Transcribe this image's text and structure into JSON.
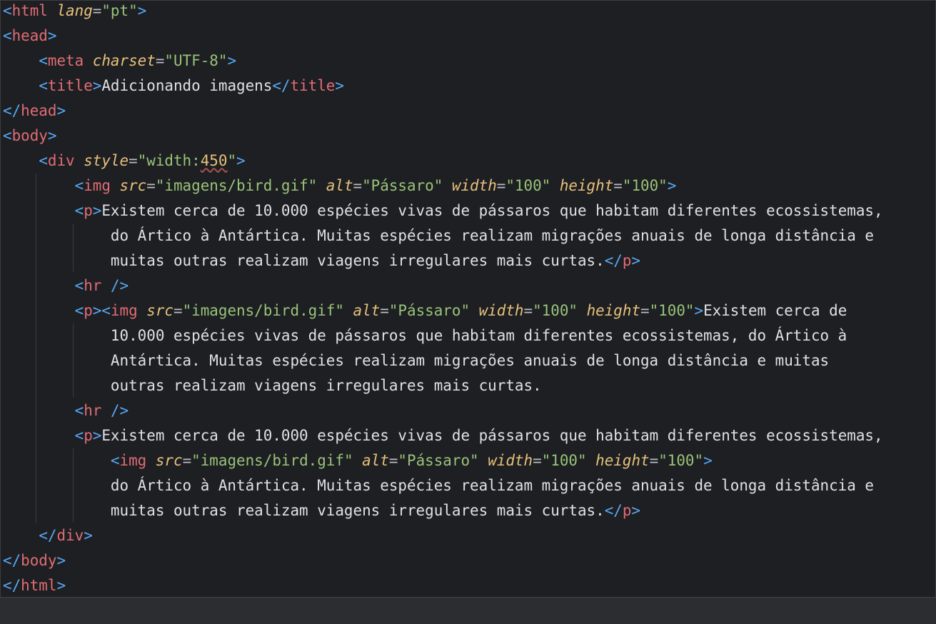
{
  "editor": {
    "language": "html",
    "lines": [
      [
        {
          "k": "p",
          "t": "<"
        },
        {
          "k": "t",
          "t": "html"
        },
        {
          "k": "o",
          "t": " "
        },
        {
          "k": "a",
          "t": "lang"
        },
        {
          "k": "o",
          "t": "="
        },
        {
          "k": "v",
          "t": "\"pt\""
        },
        {
          "k": "p",
          "t": ">"
        }
      ],
      [
        {
          "k": "p",
          "t": "<"
        },
        {
          "k": "t",
          "t": "head"
        },
        {
          "k": "p",
          "t": ">"
        }
      ],
      [
        {
          "k": "o",
          "t": "    "
        },
        {
          "k": "p",
          "t": "<"
        },
        {
          "k": "t",
          "t": "meta"
        },
        {
          "k": "o",
          "t": " "
        },
        {
          "k": "a",
          "t": "charset"
        },
        {
          "k": "o",
          "t": "="
        },
        {
          "k": "v",
          "t": "\"UTF-8\""
        },
        {
          "k": "p",
          "t": ">"
        }
      ],
      [
        {
          "k": "o",
          "t": "    "
        },
        {
          "k": "p",
          "t": "<"
        },
        {
          "k": "t",
          "t": "title"
        },
        {
          "k": "p",
          "t": ">"
        },
        {
          "k": "x",
          "t": "Adicionando imagens"
        },
        {
          "k": "p",
          "t": "</"
        },
        {
          "k": "t",
          "t": "title"
        },
        {
          "k": "p",
          "t": ">"
        }
      ],
      [
        {
          "k": "p",
          "t": "</"
        },
        {
          "k": "t",
          "t": "head"
        },
        {
          "k": "p",
          "t": ">"
        }
      ],
      [
        {
          "k": "p",
          "t": "<"
        },
        {
          "k": "t",
          "t": "body"
        },
        {
          "k": "p",
          "t": ">"
        }
      ],
      [
        {
          "k": "o",
          "t": "    "
        },
        {
          "k": "p",
          "t": "<"
        },
        {
          "k": "t",
          "t": "div"
        },
        {
          "k": "o",
          "t": " "
        },
        {
          "k": "a",
          "t": "style"
        },
        {
          "k": "o",
          "t": "="
        },
        {
          "k": "v",
          "t": "\"width:"
        },
        {
          "k": "n",
          "t": "450"
        },
        {
          "k": "v",
          "t": "\""
        },
        {
          "k": "p",
          "t": ">"
        }
      ],
      [
        {
          "k": "o",
          "t": "        "
        },
        {
          "k": "p",
          "t": "<"
        },
        {
          "k": "t",
          "t": "img"
        },
        {
          "k": "o",
          "t": " "
        },
        {
          "k": "a",
          "t": "src"
        },
        {
          "k": "o",
          "t": "="
        },
        {
          "k": "v",
          "t": "\"imagens/bird.gif\""
        },
        {
          "k": "o",
          "t": " "
        },
        {
          "k": "a",
          "t": "alt"
        },
        {
          "k": "o",
          "t": "="
        },
        {
          "k": "v",
          "t": "\"Pássaro\""
        },
        {
          "k": "o",
          "t": " "
        },
        {
          "k": "a",
          "t": "width"
        },
        {
          "k": "o",
          "t": "="
        },
        {
          "k": "v",
          "t": "\"100\""
        },
        {
          "k": "o",
          "t": " "
        },
        {
          "k": "a",
          "t": "height"
        },
        {
          "k": "o",
          "t": "="
        },
        {
          "k": "v",
          "t": "\"100\""
        },
        {
          "k": "p",
          "t": ">"
        }
      ],
      [
        {
          "k": "o",
          "t": "        "
        },
        {
          "k": "p",
          "t": "<"
        },
        {
          "k": "t",
          "t": "p"
        },
        {
          "k": "p",
          "t": ">"
        },
        {
          "k": "x",
          "t": "Existem cerca de 10.000 espécies vivas de pássaros que habitam diferentes ecossistemas,"
        }
      ],
      [
        {
          "k": "x",
          "t": "            do Ártico à Antártica. Muitas espécies realizam migrações anuais de longa distância e"
        }
      ],
      [
        {
          "k": "x",
          "t": "            muitas outras realizam viagens irregulares mais curtas."
        },
        {
          "k": "p",
          "t": "</"
        },
        {
          "k": "t",
          "t": "p"
        },
        {
          "k": "p",
          "t": ">"
        }
      ],
      [
        {
          "k": "o",
          "t": "        "
        },
        {
          "k": "p",
          "t": "<"
        },
        {
          "k": "t",
          "t": "hr"
        },
        {
          "k": "o",
          "t": " "
        },
        {
          "k": "p",
          "t": "/>"
        }
      ],
      [
        {
          "k": "o",
          "t": "        "
        },
        {
          "k": "p",
          "t": "<"
        },
        {
          "k": "t",
          "t": "p"
        },
        {
          "k": "p",
          "t": "><"
        },
        {
          "k": "t",
          "t": "img"
        },
        {
          "k": "o",
          "t": " "
        },
        {
          "k": "a",
          "t": "src"
        },
        {
          "k": "o",
          "t": "="
        },
        {
          "k": "v",
          "t": "\"imagens/bird.gif\""
        },
        {
          "k": "o",
          "t": " "
        },
        {
          "k": "a",
          "t": "alt"
        },
        {
          "k": "o",
          "t": "="
        },
        {
          "k": "v",
          "t": "\"Pássaro\""
        },
        {
          "k": "o",
          "t": " "
        },
        {
          "k": "a",
          "t": "width"
        },
        {
          "k": "o",
          "t": "="
        },
        {
          "k": "v",
          "t": "\"100\""
        },
        {
          "k": "o",
          "t": " "
        },
        {
          "k": "a",
          "t": "height"
        },
        {
          "k": "o",
          "t": "="
        },
        {
          "k": "v",
          "t": "\"100\""
        },
        {
          "k": "p",
          "t": ">"
        },
        {
          "k": "x",
          "t": "Existem cerca de"
        }
      ],
      [
        {
          "k": "x",
          "t": "            10.000 espécies vivas de pássaros que habitam diferentes ecossistemas, do Ártico à"
        }
      ],
      [
        {
          "k": "x",
          "t": "            Antártica. Muitas espécies realizam migrações anuais de longa distância e muitas"
        }
      ],
      [
        {
          "k": "x",
          "t": "            outras realizam viagens irregulares mais curtas."
        }
      ],
      [
        {
          "k": "o",
          "t": "        "
        },
        {
          "k": "p",
          "t": "<"
        },
        {
          "k": "t",
          "t": "hr"
        },
        {
          "k": "o",
          "t": " "
        },
        {
          "k": "p",
          "t": "/>"
        }
      ],
      [
        {
          "k": "o",
          "t": "        "
        },
        {
          "k": "p",
          "t": "<"
        },
        {
          "k": "t",
          "t": "p"
        },
        {
          "k": "p",
          "t": ">"
        },
        {
          "k": "x",
          "t": "Existem cerca de 10.000 espécies vivas de pássaros que habitam diferentes ecossistemas,"
        }
      ],
      [
        {
          "k": "o",
          "t": "            "
        },
        {
          "k": "p",
          "t": "<"
        },
        {
          "k": "t",
          "t": "img"
        },
        {
          "k": "o",
          "t": " "
        },
        {
          "k": "a",
          "t": "src"
        },
        {
          "k": "o",
          "t": "="
        },
        {
          "k": "v",
          "t": "\"imagens/bird.gif\""
        },
        {
          "k": "o",
          "t": " "
        },
        {
          "k": "a",
          "t": "alt"
        },
        {
          "k": "o",
          "t": "="
        },
        {
          "k": "v",
          "t": "\"Pássaro\""
        },
        {
          "k": "o",
          "t": " "
        },
        {
          "k": "a",
          "t": "width"
        },
        {
          "k": "o",
          "t": "="
        },
        {
          "k": "v",
          "t": "\"100\""
        },
        {
          "k": "o",
          "t": " "
        },
        {
          "k": "a",
          "t": "height"
        },
        {
          "k": "o",
          "t": "="
        },
        {
          "k": "v",
          "t": "\"100\""
        },
        {
          "k": "p",
          "t": ">"
        }
      ],
      [
        {
          "k": "x",
          "t": "            do Ártico à Antártica. Muitas espécies realizam migrações anuais de longa distância e"
        }
      ],
      [
        {
          "k": "x",
          "t": "            muitas outras realizam viagens irregulares mais curtas."
        },
        {
          "k": "p",
          "t": "</"
        },
        {
          "k": "t",
          "t": "p"
        },
        {
          "k": "p",
          "t": ">"
        }
      ],
      [
        {
          "k": "o",
          "t": "    "
        },
        {
          "k": "p",
          "t": "</"
        },
        {
          "k": "t",
          "t": "div"
        },
        {
          "k": "p",
          "t": ">"
        }
      ],
      [
        {
          "k": "p",
          "t": "</"
        },
        {
          "k": "t",
          "t": "body"
        },
        {
          "k": "p",
          "t": ">"
        }
      ],
      [
        {
          "k": "p",
          "t": "</"
        },
        {
          "k": "t",
          "t": "html"
        },
        {
          "k": "p",
          "t": ">"
        }
      ]
    ]
  },
  "colors": {
    "background": "#1e1f22",
    "bracket": "#56a8f5",
    "tag": "#e06c75",
    "attribute": "#e5c07b",
    "value": "#98c379",
    "text": "#dfe1e5"
  }
}
